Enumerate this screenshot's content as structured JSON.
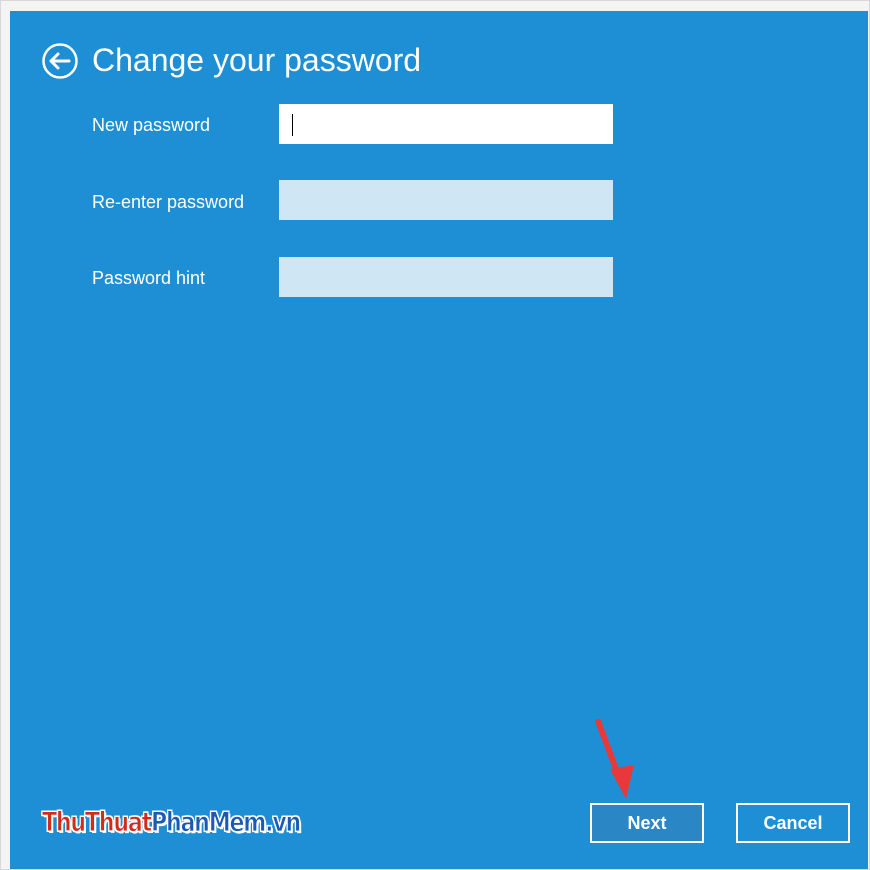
{
  "dialog": {
    "title": "Change your password",
    "back_icon": "back-arrow-circle-icon"
  },
  "fields": {
    "new_password": {
      "label": "New password",
      "value": ""
    },
    "reenter_password": {
      "label": "Re-enter password",
      "value": ""
    },
    "password_hint": {
      "label": "Password hint",
      "value": ""
    }
  },
  "buttons": {
    "next_label": "Next",
    "cancel_label": "Cancel"
  },
  "annotation": {
    "icon": "red-pointer-arrow-icon",
    "color": "#e8393a"
  },
  "watermark": {
    "part1": "ThuThuat",
    "part2": "PhanMem",
    "part3": ".vn"
  },
  "colors": {
    "panel_bg": "#1e8fd5",
    "field_active": "#ffffff",
    "field_inactive": "#cfe7f5",
    "watermark_red": "#d42a1c",
    "watermark_blue": "#1c59b5"
  }
}
